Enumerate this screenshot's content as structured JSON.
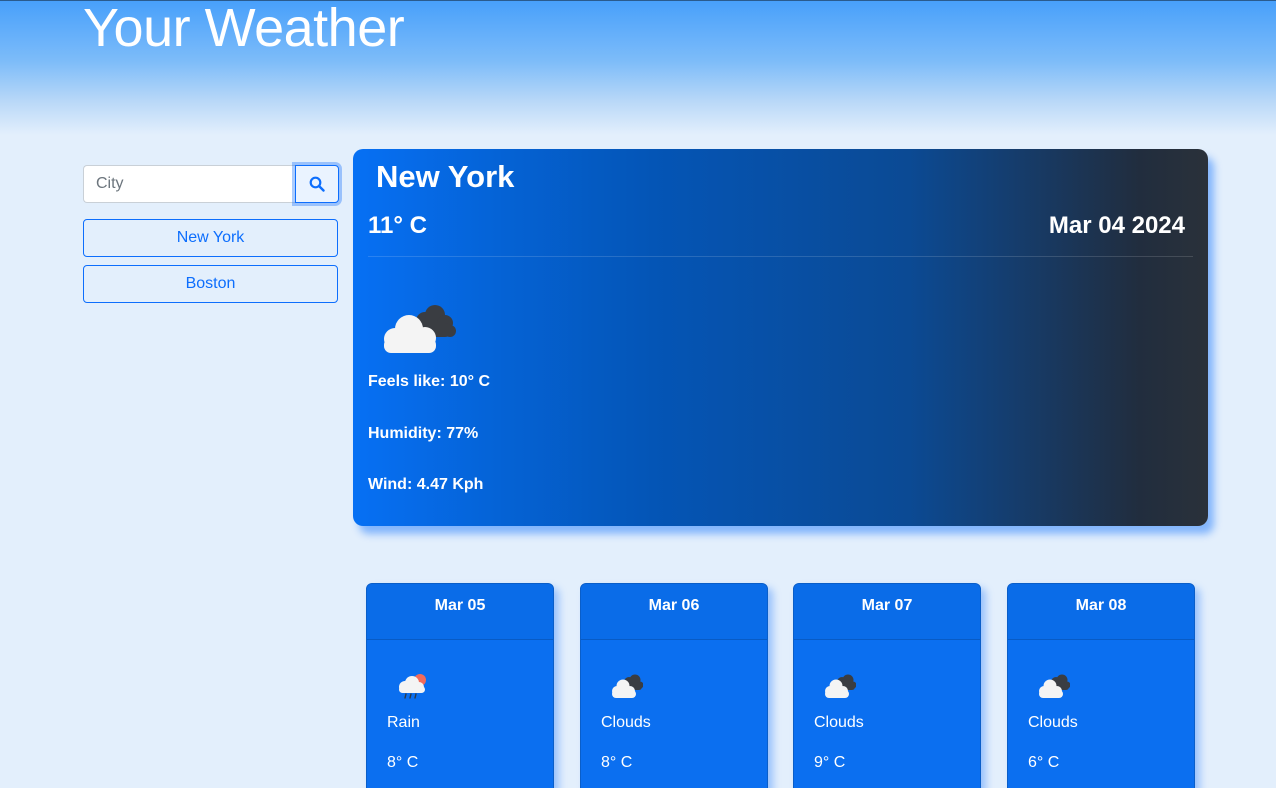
{
  "header": {
    "title": "Your Weather"
  },
  "search": {
    "placeholder": "City",
    "button_icon": "search-icon"
  },
  "history": [
    {
      "label": "New York"
    },
    {
      "label": "Boston"
    }
  ],
  "current": {
    "city": "New York",
    "temp": "11° C",
    "date": "Mar 04 2024",
    "icon": "clouds-icon",
    "feels_like": "Feels like: 10° C",
    "humidity": "Humidity: 77%",
    "wind": "Wind: 4.47 Kph"
  },
  "forecast": [
    {
      "date": "Mar 05",
      "icon": "rain-icon",
      "desc": "Rain",
      "temp": "8° C"
    },
    {
      "date": "Mar 06",
      "icon": "clouds-icon",
      "desc": "Clouds",
      "temp": "8° C"
    },
    {
      "date": "Mar 07",
      "icon": "clouds-icon",
      "desc": "Clouds",
      "temp": "9° C"
    },
    {
      "date": "Mar 08",
      "icon": "clouds-icon",
      "desc": "Clouds",
      "temp": "6° C"
    }
  ],
  "colors": {
    "accent": "#0d6efd",
    "background": "#e3effc"
  }
}
